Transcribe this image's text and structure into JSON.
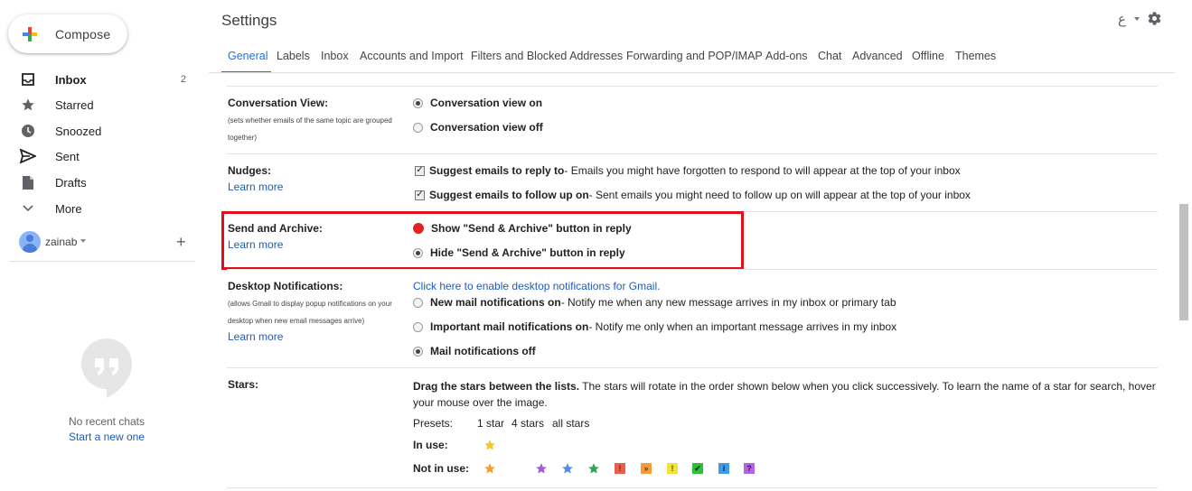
{
  "sidebar": {
    "compose_label": "Compose",
    "items": [
      {
        "label": "Inbox",
        "count": "2",
        "icon": "inbox-icon"
      },
      {
        "label": "Starred",
        "count": "",
        "icon": "star-icon"
      },
      {
        "label": "Snoozed",
        "count": "",
        "icon": "clock-icon"
      },
      {
        "label": "Sent",
        "count": "",
        "icon": "send-icon"
      },
      {
        "label": "Drafts",
        "count": "",
        "icon": "draft-icon"
      },
      {
        "label": "More",
        "count": "",
        "icon": "chevron-down-icon"
      }
    ],
    "account_name": "zainab",
    "add_account": "+",
    "no_chats": "No recent chats",
    "start_new": "Start a new one"
  },
  "header": {
    "title": "Settings",
    "language_glyph": "ع"
  },
  "tabs": [
    {
      "label": "General"
    },
    {
      "label": "Labels"
    },
    {
      "label": "Inbox"
    },
    {
      "label": "Accounts and Import"
    },
    {
      "label": "Filters and Blocked Addresses"
    },
    {
      "label": "Forwarding and POP/IMAP"
    },
    {
      "label": "Add-ons"
    },
    {
      "label": "Chat"
    },
    {
      "label": "Advanced"
    },
    {
      "label": "Offline"
    },
    {
      "label": "Themes"
    }
  ],
  "settings": {
    "conversation": {
      "title": "Conversation View:",
      "subtitle": "(sets whether emails of the same topic are grouped together)",
      "option_on": "Conversation view on",
      "option_off": "Conversation view off"
    },
    "nudges": {
      "title": "Nudges:",
      "learn_more": "Learn more",
      "reply_bold": "Suggest emails to reply to",
      "reply_desc": " - Emails you might have forgotten to respond to will appear at the top of your inbox",
      "follow_bold": "Suggest emails to follow up on",
      "follow_desc": " - Sent emails you might need to follow up on will appear at the top of your inbox"
    },
    "send_archive": {
      "title": "Send and Archive:",
      "learn_more": "Learn more",
      "show": "Show \"Send & Archive\" button in reply",
      "hide": "Hide \"Send & Archive\" button in reply"
    },
    "desktop": {
      "title": "Desktop Notifications:",
      "subtitle": "(allows Gmail to display popup notifications on your desktop when new email messages arrive)",
      "learn_more": "Learn more",
      "enable_link": "Click here to enable desktop notifications for Gmail.",
      "new_bold": "New mail notifications on",
      "new_desc": " - Notify me when any new message arrives in my inbox or primary tab",
      "important_bold": "Important mail notifications on",
      "important_desc": " - Notify me only when an important message arrives in my inbox",
      "off": "Mail notifications off"
    },
    "stars": {
      "title": "Stars:",
      "drag_bold": "Drag the stars between the lists.",
      "drag_desc": "  The stars will rotate in the order shown below when you click successively. To learn the name of a star for search, hover your mouse over the image.",
      "presets_label": "Presets:",
      "preset_1": "1 star",
      "preset_4": "4 stars",
      "preset_all": "all stars",
      "in_use_label": "In use:",
      "not_in_use_label": "Not in use:",
      "in_use": [
        {
          "icon": "yellow-star-icon",
          "color": "#f4c430"
        }
      ],
      "not_in_use": [
        {
          "icon": "orange-star-icon",
          "color": "#f4a030"
        },
        {
          "icon": "purple-star-icon",
          "color": "#a55cd8"
        },
        {
          "icon": "blue-star-icon",
          "color": "#4f8ef0"
        },
        {
          "icon": "green-star-icon",
          "color": "#2fa65a"
        },
        {
          "icon": "red-bang-icon",
          "color": "#e8604c",
          "glyph": "!"
        },
        {
          "icon": "orange-guillemet-icon",
          "color": "#f59b3b",
          "glyph": "»"
        },
        {
          "icon": "yellow-bang-icon",
          "color": "#f5e23b",
          "glyph": "!"
        },
        {
          "icon": "green-check-icon",
          "color": "#2fbf3a",
          "glyph": "✔"
        },
        {
          "icon": "blue-info-icon",
          "color": "#3f9be6",
          "glyph": "i"
        },
        {
          "icon": "purple-question-icon",
          "color": "#b366e0",
          "glyph": "?"
        }
      ]
    }
  }
}
